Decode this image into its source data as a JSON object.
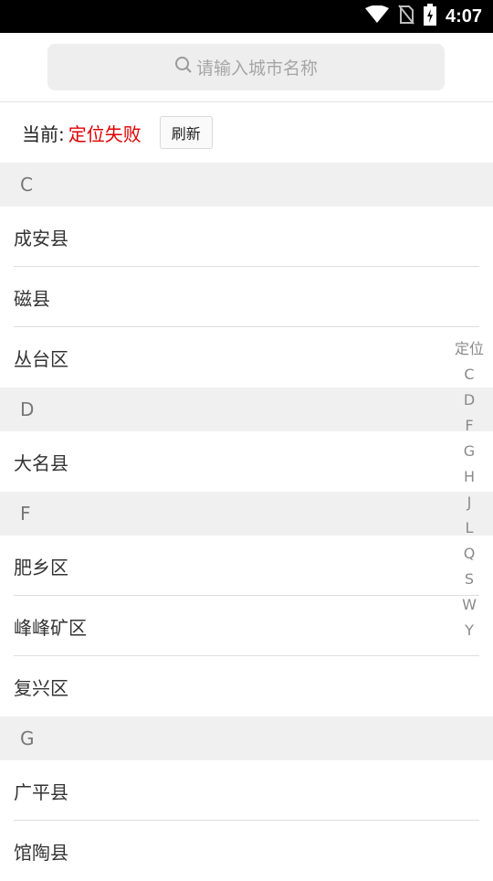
{
  "status_bar": {
    "time": "4:07",
    "icons": [
      "wifi-icon",
      "no-sim-icon",
      "battery-charging-icon"
    ]
  },
  "search": {
    "placeholder": "请输入城市名称",
    "icon": "search-icon"
  },
  "current_location": {
    "label": "当前:",
    "value": "定位失败",
    "refresh_label": "刷新"
  },
  "sections": [
    {
      "letter": "C",
      "cities": [
        "成安县",
        "磁县",
        "丛台区"
      ]
    },
    {
      "letter": "D",
      "cities": [
        "大名县"
      ]
    },
    {
      "letter": "F",
      "cities": [
        "肥乡区",
        "峰峰矿区",
        "复兴区"
      ]
    },
    {
      "letter": "G",
      "cities": [
        "广平县",
        "馆陶县"
      ]
    }
  ],
  "index_bar": [
    "定位",
    "C",
    "D",
    "F",
    "G",
    "H",
    "J",
    "L",
    "Q",
    "S",
    "W",
    "Y"
  ],
  "colors": {
    "accent_red": "#e00000",
    "section_bg": "#f0f0f0",
    "search_bg": "#eeeeee"
  }
}
